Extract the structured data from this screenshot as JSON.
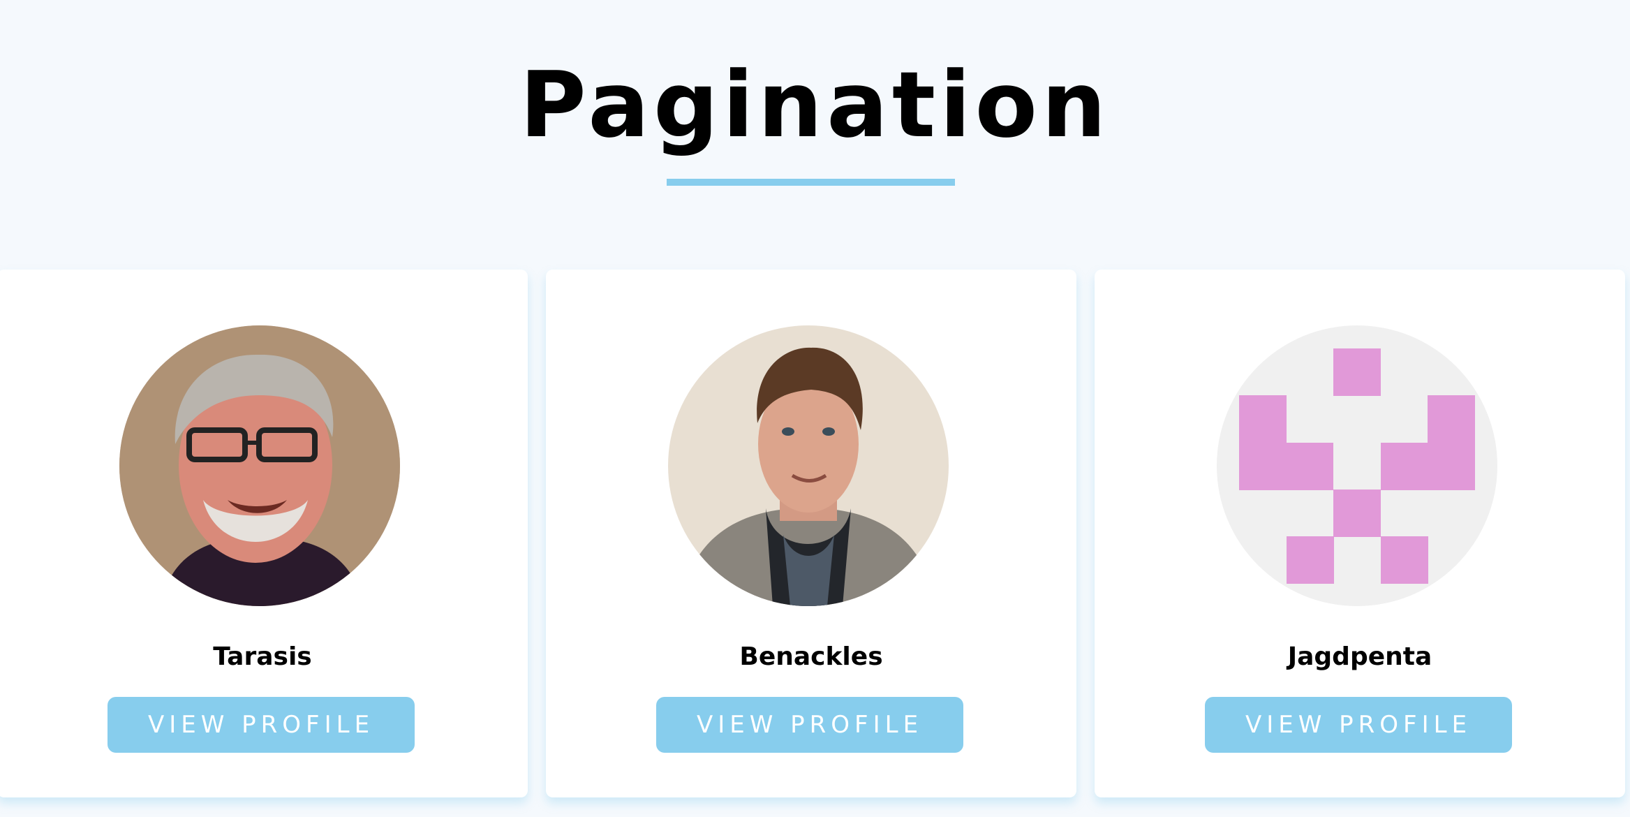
{
  "header": {
    "title": "Pagination"
  },
  "colors": {
    "background": "#f5f9fd",
    "accent": "#87cded",
    "card": "#ffffff",
    "identicon": "#e199d8",
    "identicon_background": "#f0f0f0"
  },
  "cards": [
    {
      "name": "Tarasis",
      "button_label": "VIEW PROFILE",
      "avatar": "photo-avatar"
    },
    {
      "name": "Benackles",
      "button_label": "VIEW PROFILE",
      "avatar": "photo-avatar"
    },
    {
      "name": "Jagdpenta",
      "button_label": "VIEW PROFILE",
      "avatar": "identicon-avatar"
    }
  ]
}
